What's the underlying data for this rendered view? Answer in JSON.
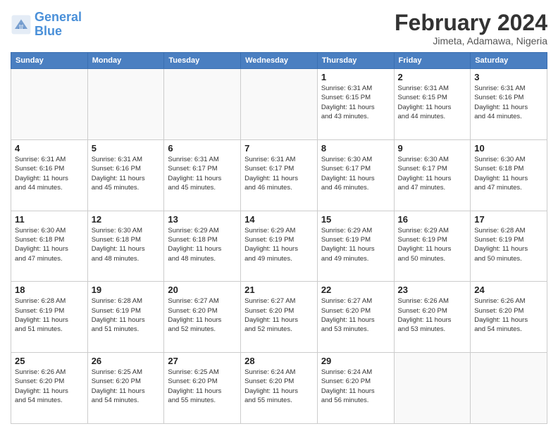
{
  "header": {
    "logo_line1": "General",
    "logo_line2": "Blue",
    "month_title": "February 2024",
    "location": "Jimeta, Adamawa, Nigeria"
  },
  "days_of_week": [
    "Sunday",
    "Monday",
    "Tuesday",
    "Wednesday",
    "Thursday",
    "Friday",
    "Saturday"
  ],
  "weeks": [
    [
      {
        "day": "",
        "info": ""
      },
      {
        "day": "",
        "info": ""
      },
      {
        "day": "",
        "info": ""
      },
      {
        "day": "",
        "info": ""
      },
      {
        "day": "1",
        "info": "Sunrise: 6:31 AM\nSunset: 6:15 PM\nDaylight: 11 hours\nand 43 minutes."
      },
      {
        "day": "2",
        "info": "Sunrise: 6:31 AM\nSunset: 6:15 PM\nDaylight: 11 hours\nand 44 minutes."
      },
      {
        "day": "3",
        "info": "Sunrise: 6:31 AM\nSunset: 6:16 PM\nDaylight: 11 hours\nand 44 minutes."
      }
    ],
    [
      {
        "day": "4",
        "info": "Sunrise: 6:31 AM\nSunset: 6:16 PM\nDaylight: 11 hours\nand 44 minutes."
      },
      {
        "day": "5",
        "info": "Sunrise: 6:31 AM\nSunset: 6:16 PM\nDaylight: 11 hours\nand 45 minutes."
      },
      {
        "day": "6",
        "info": "Sunrise: 6:31 AM\nSunset: 6:17 PM\nDaylight: 11 hours\nand 45 minutes."
      },
      {
        "day": "7",
        "info": "Sunrise: 6:31 AM\nSunset: 6:17 PM\nDaylight: 11 hours\nand 46 minutes."
      },
      {
        "day": "8",
        "info": "Sunrise: 6:30 AM\nSunset: 6:17 PM\nDaylight: 11 hours\nand 46 minutes."
      },
      {
        "day": "9",
        "info": "Sunrise: 6:30 AM\nSunset: 6:17 PM\nDaylight: 11 hours\nand 47 minutes."
      },
      {
        "day": "10",
        "info": "Sunrise: 6:30 AM\nSunset: 6:18 PM\nDaylight: 11 hours\nand 47 minutes."
      }
    ],
    [
      {
        "day": "11",
        "info": "Sunrise: 6:30 AM\nSunset: 6:18 PM\nDaylight: 11 hours\nand 47 minutes."
      },
      {
        "day": "12",
        "info": "Sunrise: 6:30 AM\nSunset: 6:18 PM\nDaylight: 11 hours\nand 48 minutes."
      },
      {
        "day": "13",
        "info": "Sunrise: 6:29 AM\nSunset: 6:18 PM\nDaylight: 11 hours\nand 48 minutes."
      },
      {
        "day": "14",
        "info": "Sunrise: 6:29 AM\nSunset: 6:19 PM\nDaylight: 11 hours\nand 49 minutes."
      },
      {
        "day": "15",
        "info": "Sunrise: 6:29 AM\nSunset: 6:19 PM\nDaylight: 11 hours\nand 49 minutes."
      },
      {
        "day": "16",
        "info": "Sunrise: 6:29 AM\nSunset: 6:19 PM\nDaylight: 11 hours\nand 50 minutes."
      },
      {
        "day": "17",
        "info": "Sunrise: 6:28 AM\nSunset: 6:19 PM\nDaylight: 11 hours\nand 50 minutes."
      }
    ],
    [
      {
        "day": "18",
        "info": "Sunrise: 6:28 AM\nSunset: 6:19 PM\nDaylight: 11 hours\nand 51 minutes."
      },
      {
        "day": "19",
        "info": "Sunrise: 6:28 AM\nSunset: 6:19 PM\nDaylight: 11 hours\nand 51 minutes."
      },
      {
        "day": "20",
        "info": "Sunrise: 6:27 AM\nSunset: 6:20 PM\nDaylight: 11 hours\nand 52 minutes."
      },
      {
        "day": "21",
        "info": "Sunrise: 6:27 AM\nSunset: 6:20 PM\nDaylight: 11 hours\nand 52 minutes."
      },
      {
        "day": "22",
        "info": "Sunrise: 6:27 AM\nSunset: 6:20 PM\nDaylight: 11 hours\nand 53 minutes."
      },
      {
        "day": "23",
        "info": "Sunrise: 6:26 AM\nSunset: 6:20 PM\nDaylight: 11 hours\nand 53 minutes."
      },
      {
        "day": "24",
        "info": "Sunrise: 6:26 AM\nSunset: 6:20 PM\nDaylight: 11 hours\nand 54 minutes."
      }
    ],
    [
      {
        "day": "25",
        "info": "Sunrise: 6:26 AM\nSunset: 6:20 PM\nDaylight: 11 hours\nand 54 minutes."
      },
      {
        "day": "26",
        "info": "Sunrise: 6:25 AM\nSunset: 6:20 PM\nDaylight: 11 hours\nand 54 minutes."
      },
      {
        "day": "27",
        "info": "Sunrise: 6:25 AM\nSunset: 6:20 PM\nDaylight: 11 hours\nand 55 minutes."
      },
      {
        "day": "28",
        "info": "Sunrise: 6:24 AM\nSunset: 6:20 PM\nDaylight: 11 hours\nand 55 minutes."
      },
      {
        "day": "29",
        "info": "Sunrise: 6:24 AM\nSunset: 6:20 PM\nDaylight: 11 hours\nand 56 minutes."
      },
      {
        "day": "",
        "info": ""
      },
      {
        "day": "",
        "info": ""
      }
    ]
  ]
}
